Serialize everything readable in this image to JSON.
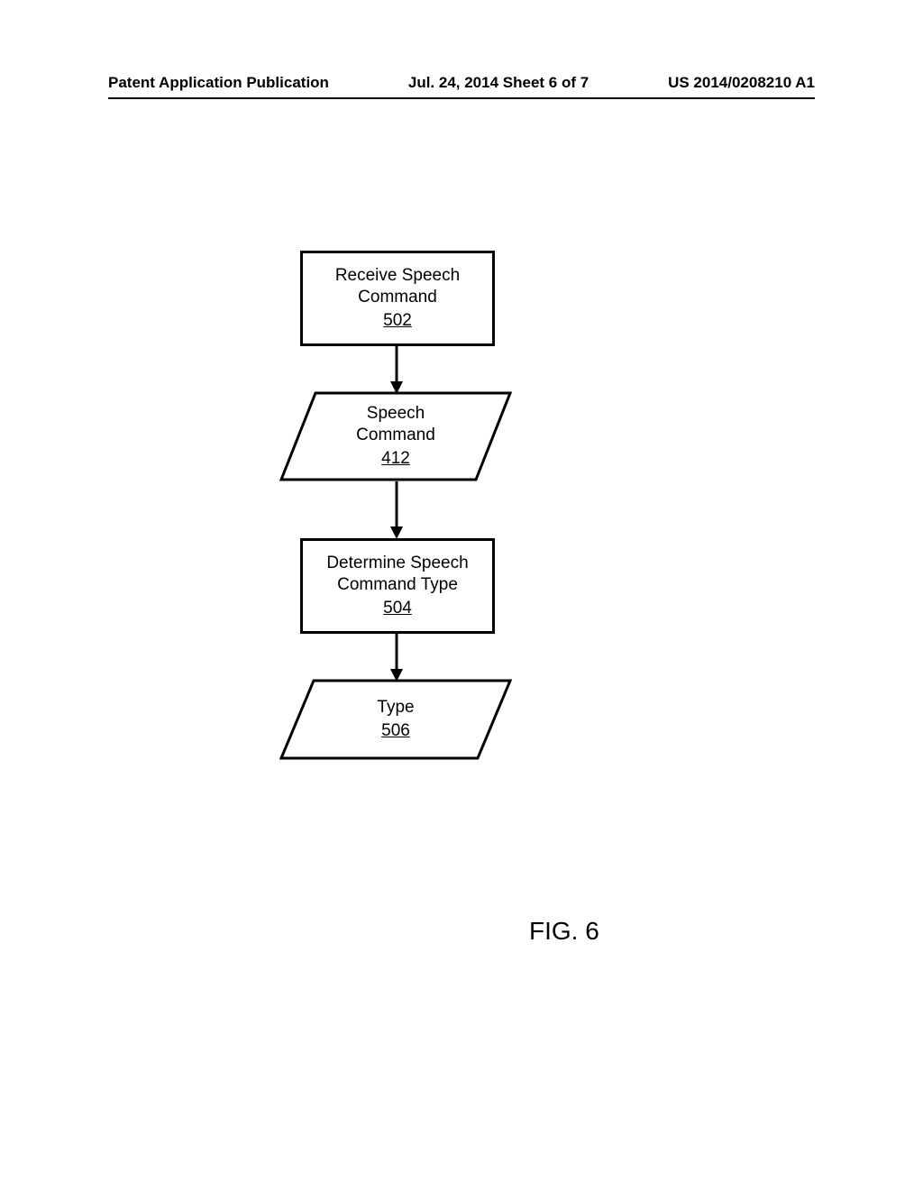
{
  "header": {
    "left": "Patent Application Publication",
    "center": "Jul. 24, 2014  Sheet 6 of 7",
    "right": "US 2014/0208210 A1"
  },
  "flowchart": {
    "box1": {
      "line1": "Receive Speech",
      "line2": "Command",
      "ref": "502"
    },
    "para1": {
      "line1": "Speech",
      "line2": "Command",
      "ref": "412"
    },
    "box2": {
      "line1": "Determine Speech",
      "line2": "Command Type",
      "ref": "504"
    },
    "para2": {
      "line1": "Type",
      "ref": "506"
    }
  },
  "figure_label": "FIG. 6"
}
